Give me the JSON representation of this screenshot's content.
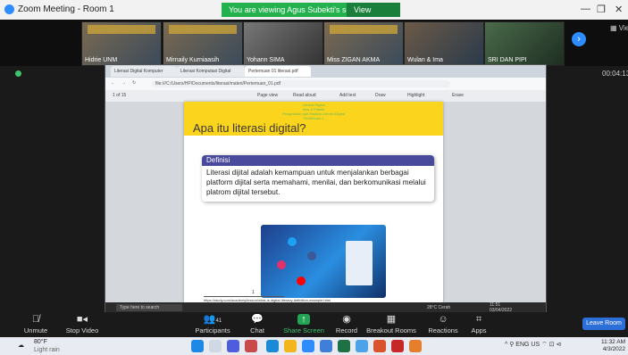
{
  "window": {
    "title": "Zoom Meeting - Room 1",
    "share_banner": "You are viewing Agus Subekti's screen",
    "view_options": "View Options ⌄",
    "controls": [
      "—",
      "❐",
      "✕"
    ]
  },
  "participants": [
    {
      "name": "Hidrie UNM"
    },
    {
      "name": "Mirnaily Kurniaasih"
    },
    {
      "name": "Yohann SIMA"
    },
    {
      "name": "Miss ZIGAN AKMA"
    },
    {
      "name": "Wulan & Ima"
    },
    {
      "name": "SRI DAN PIPI"
    }
  ],
  "view_label": "View",
  "timer": "00:04:13",
  "browser": {
    "tabs": [
      "Literasi Digital Komputer",
      "Literasi Komputasi Digital",
      "Pertemuan 01 literasi.pdf"
    ],
    "url": "file:///C:/Users/HP/Documents/literasi/materi/Pertemuan_01.pdf",
    "pdf_toolbar": {
      "page": "1 of 15",
      "page_view": "Page view",
      "read_aloud": "Read aloud",
      "add_text": "Add text",
      "draw": "Draw",
      "highlight": "Highlight",
      "erase": "Erase"
    }
  },
  "slide": {
    "header_lines": [
      "Literasi Digital",
      "Ilmu & Praktik",
      "Pengenalan dan Hakikat Literasi Digital",
      "Pertemuan 1"
    ],
    "title": "Apa itu literasi digital?",
    "definition_heading": "Definisi",
    "definition_text": "Literasi dijital adalah kemampuan untuk menjalankan berbagai platform dijital serta memahami, menilai, dan berkomunikasi melalui platrom dijital tersebut.",
    "footnote_number": "1",
    "footnote": "https://study.com/academy/lesson/what-is-digital-literacy-definition-example.html"
  },
  "inner_taskbar": {
    "search_placeholder": "Type here to search",
    "weather": "28°C Cerah",
    "time": "11:51",
    "date": "03/04/2022"
  },
  "controls": [
    {
      "label": "Unmute",
      "icon": "mic-muted-icon"
    },
    {
      "label": "Stop Video",
      "icon": "video-icon"
    },
    {
      "label": "Participants",
      "count": "41",
      "icon": "participants-icon"
    },
    {
      "label": "Chat",
      "icon": "chat-icon"
    },
    {
      "label": "Share Screen",
      "icon": "share-screen-icon"
    },
    {
      "label": "Record",
      "icon": "record-icon"
    },
    {
      "label": "Breakout Rooms",
      "icon": "breakout-icon"
    },
    {
      "label": "Reactions",
      "icon": "reactions-icon"
    },
    {
      "label": "Apps",
      "icon": "apps-icon"
    }
  ],
  "leave_label": "Leave Room",
  "host_taskbar": {
    "weather_temp": "80°F",
    "weather_cond": "Light rain",
    "tray": "^ ⚲ ENG US ⌔ ⊡ ⊲",
    "time": "11:32 AM",
    "date": "4/3/2022"
  },
  "colors": {
    "zoom_blue": "#2d8cff",
    "share_green": "#22b14c",
    "slide_yellow": "#fbd41e",
    "definition_blue": "#4a4a9c"
  }
}
